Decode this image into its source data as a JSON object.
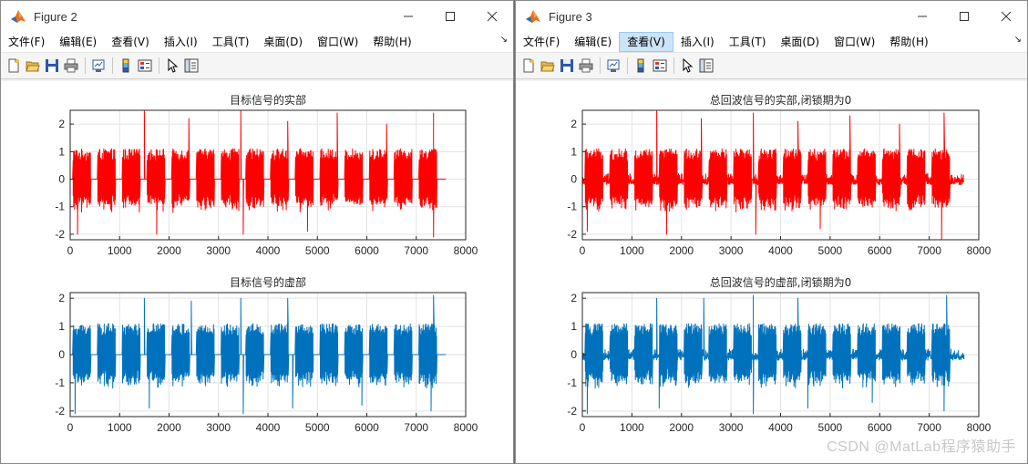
{
  "windows": [
    {
      "id": "fig2",
      "title": "Figure 2",
      "menus": [
        "文件(F)",
        "编辑(E)",
        "查看(V)",
        "插入(I)",
        "工具(T)",
        "桌面(D)",
        "窗口(W)",
        "帮助(H)"
      ],
      "active_menu_index": -1
    },
    {
      "id": "fig3",
      "title": "Figure 3",
      "menus": [
        "文件(F)",
        "编辑(E)",
        "查看(V)",
        "插入(I)",
        "工具(T)",
        "桌面(D)",
        "窗口(W)",
        "帮助(H)"
      ],
      "active_menu_index": 2
    }
  ],
  "toolbar_icons": [
    "new-figure-icon",
    "open-file-icon",
    "save-icon",
    "print-icon",
    "link-plot-icon",
    "insert-colorbar-icon",
    "insert-legend-icon",
    "edit-plot-icon",
    "property-inspector-icon"
  ],
  "colors": {
    "real": "#ff0000",
    "imag": "#0072bd"
  },
  "watermark": "CSDN @MatLab程序猿助手",
  "chart_data": [
    {
      "type": "line",
      "window": "fig2",
      "panel": "top",
      "title": "目标信号的实部",
      "xlim": [
        0,
        8000
      ],
      "ylim": [
        -2.2,
        2.5
      ],
      "xticks": [
        0,
        1000,
        2000,
        3000,
        4000,
        5000,
        6000,
        7000,
        8000
      ],
      "yticks": [
        -2,
        -1,
        0,
        1,
        2
      ],
      "grid": true,
      "color": "#ff0000",
      "signal": "real",
      "noise": "none",
      "x_end": 7600,
      "pulse_starts": [
        0,
        500,
        1000,
        1500,
        2000,
        2500,
        3000,
        3500,
        4000,
        4500,
        5000,
        5500,
        6000,
        6500,
        7000
      ],
      "pulse_width": 350,
      "peaks": [
        [
          1500,
          2.5
        ],
        [
          2400,
          2.2
        ],
        [
          3450,
          2.5
        ],
        [
          4400,
          2.1
        ],
        [
          5400,
          2.4
        ],
        [
          6400,
          2.0
        ],
        [
          7350,
          2.4
        ],
        [
          150,
          -2.0
        ],
        [
          1750,
          -2.0
        ],
        [
          3500,
          -2.0
        ],
        [
          4800,
          -1.9
        ],
        [
          7350,
          -2.1
        ]
      ]
    },
    {
      "type": "line",
      "window": "fig2",
      "panel": "bottom",
      "title": "目标信号的虚部",
      "xlim": [
        0,
        8000
      ],
      "ylim": [
        -2.2,
        2.2
      ],
      "xticks": [
        0,
        1000,
        2000,
        3000,
        4000,
        5000,
        6000,
        7000,
        8000
      ],
      "yticks": [
        -2,
        -1,
        0,
        1,
        2
      ],
      "grid": true,
      "color": "#0072bd",
      "signal": "imag",
      "noise": "none",
      "x_end": 7600,
      "pulse_starts": [
        0,
        500,
        1000,
        1500,
        2000,
        2500,
        3000,
        3500,
        4000,
        4500,
        5000,
        5500,
        6000,
        6500,
        7000
      ],
      "pulse_width": 350,
      "peaks": [
        [
          1500,
          2.0
        ],
        [
          2450,
          1.9
        ],
        [
          3450,
          2.0
        ],
        [
          4400,
          2.0
        ],
        [
          7350,
          2.1
        ],
        [
          100,
          -2.1
        ],
        [
          1600,
          -1.9
        ],
        [
          3500,
          -2.1
        ],
        [
          4500,
          -1.9
        ],
        [
          5900,
          -1.8
        ],
        [
          7300,
          -2.0
        ]
      ]
    },
    {
      "type": "line",
      "window": "fig3",
      "panel": "top",
      "title": "总回波信号的实部,闭锁期为0",
      "xlim": [
        0,
        8000
      ],
      "ylim": [
        -2.2,
        2.5
      ],
      "xticks": [
        0,
        1000,
        2000,
        3000,
        4000,
        5000,
        6000,
        7000,
        8000
      ],
      "yticks": [
        -2,
        -1,
        0,
        1,
        2
      ],
      "grid": true,
      "color": "#ff0000",
      "signal": "real",
      "noise": "small",
      "x_end": 7700,
      "pulse_starts": [
        0,
        500,
        1000,
        1500,
        2000,
        2500,
        3000,
        3500,
        4000,
        4500,
        5000,
        5500,
        6000,
        6500,
        7000
      ],
      "pulse_width": 350,
      "peaks": [
        [
          1500,
          2.5
        ],
        [
          2400,
          2.2
        ],
        [
          3450,
          2.4
        ],
        [
          4350,
          2.1
        ],
        [
          5400,
          2.3
        ],
        [
          6400,
          2.0
        ],
        [
          7300,
          2.4
        ],
        [
          100,
          -1.9
        ],
        [
          1700,
          -2.0
        ],
        [
          3500,
          -2.0
        ],
        [
          4800,
          -1.8
        ],
        [
          7250,
          -2.2
        ]
      ]
    },
    {
      "type": "line",
      "window": "fig3",
      "panel": "bottom",
      "title": "总回波信号的虚部,闭锁期为0",
      "xlim": [
        0,
        8000
      ],
      "ylim": [
        -2.2,
        2.2
      ],
      "xticks": [
        0,
        1000,
        2000,
        3000,
        4000,
        5000,
        6000,
        7000,
        8000
      ],
      "yticks": [
        -2,
        -1,
        0,
        1,
        2
      ],
      "grid": true,
      "color": "#0072bd",
      "signal": "imag",
      "noise": "small",
      "x_end": 7700,
      "pulse_starts": [
        0,
        500,
        1000,
        1500,
        2000,
        2500,
        3000,
        3500,
        4000,
        4500,
        5000,
        5500,
        6000,
        6500,
        7000
      ],
      "pulse_width": 350,
      "peaks": [
        [
          1500,
          2.0
        ],
        [
          2450,
          2.0
        ],
        [
          3450,
          2.1
        ],
        [
          4350,
          2.0
        ],
        [
          7350,
          2.1
        ],
        [
          100,
          -2.1
        ],
        [
          1550,
          -1.9
        ],
        [
          3450,
          -2.1
        ],
        [
          4550,
          -1.9
        ],
        [
          5850,
          -1.7
        ],
        [
          7300,
          -2.0
        ]
      ]
    }
  ]
}
